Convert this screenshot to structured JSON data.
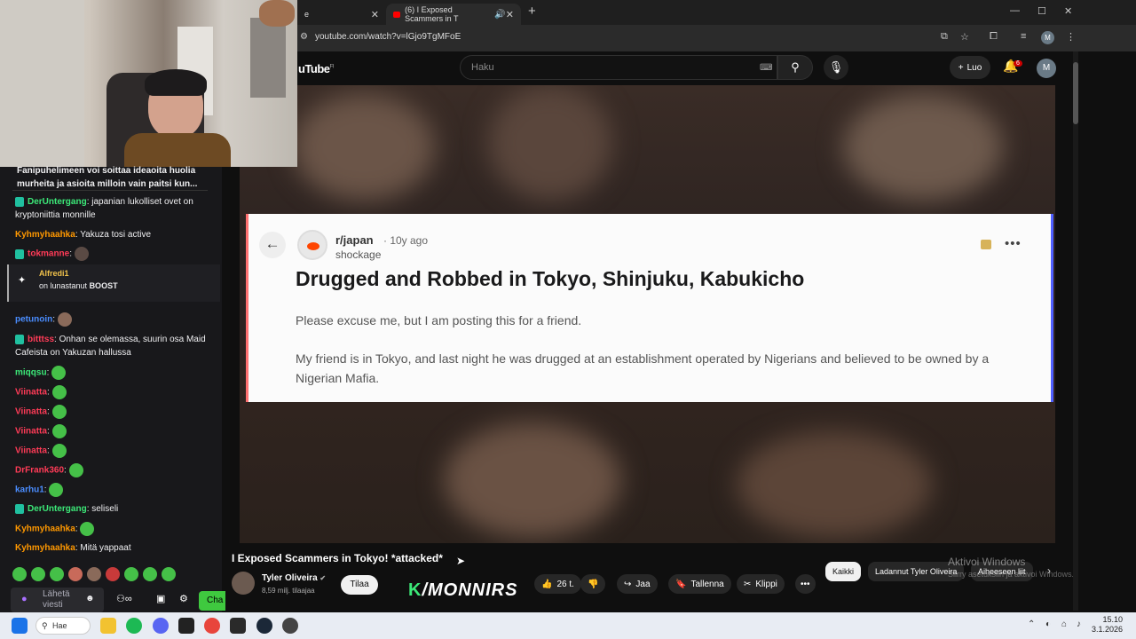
{
  "browser": {
    "tabs": [
      {
        "label": "e"
      },
      {
        "label": "(6) I Exposed Scammers in T"
      }
    ],
    "new_tab": "+",
    "url": "youtube.com/watch?v=lGjo9TgMFoE",
    "window_controls": [
      "—",
      "☐",
      "✕"
    ]
  },
  "youtube": {
    "logo": "uTube",
    "region": "FI",
    "search_placeholder": "Haku",
    "create_label": "Luo",
    "notification_count": "6",
    "avatar_letter": "M",
    "video_title": "I Exposed Scammers in Tokyo! *attacked*",
    "channel_name": "Tyler Oliveira",
    "subscribers": "8,59 milj. tilaajaa",
    "subscribe_label": "Tilaa",
    "likes": "26 t.",
    "share_label": "Jaa",
    "save_label": "Tallenna",
    "clip_label": "Klippi",
    "chips": [
      "Kaikki",
      "Ladannut Tyler Oliveira",
      "Aiheeseen liit"
    ],
    "overlay_logo": "/MONNIRS",
    "overlay_letter": "K"
  },
  "reddit_post": {
    "subreddit": "r/japan",
    "age": "· 10y ago",
    "author": "shockage",
    "title": "Drugged and Robbed in Tokyo, Shinjuku, Kabukicho",
    "para1": "Please excuse me, but I am posting this for a friend.",
    "para2": "My friend is in Tokyo, and last night he was drugged at an establishment operated by Nigerians and believed to be owned by a Nigerian Mafia."
  },
  "windows_watermark": {
    "line1": "Aktivoi Windows",
    "line2": "Siirry asetuksiin ja aktivoi Windows."
  },
  "chat": {
    "top_message": "Fanipuhelimeen voi soittaa ideaoita huolia murheita ja asioita milloin vain paitsi kun...",
    "messages": [
      {
        "user": "DerUntergang",
        "text": "japanian lukolliset ovet on kryptoniittia monnille",
        "color": "#3ce878"
      },
      {
        "user": "Kyhmyhaahka",
        "text": "Yakuza tosi active",
        "color": "#ff9800"
      },
      {
        "user": "tokmanne",
        "text": "",
        "color": "#ff3b57"
      },
      {
        "user": "petunoin",
        "text": "",
        "color": "#4a8dff"
      },
      {
        "user": "bitttss",
        "text": "Onhan se olemassa, suurin osa Maid Cafeista on Yakuzan hallussa",
        "color": "#ff3b57"
      },
      {
        "user": "miqqsu",
        "text": "",
        "color": "#3ce878"
      },
      {
        "user": "Viinatta",
        "text": "",
        "color": "#ff3b57"
      },
      {
        "user": "Viinatta",
        "text": "",
        "color": "#ff3b57"
      },
      {
        "user": "Viinatta",
        "text": "",
        "color": "#ff3b57"
      },
      {
        "user": "Viinatta",
        "text": "",
        "color": "#ff3b57"
      },
      {
        "user": "DrFrank360",
        "text": "",
        "color": "#ff3b57"
      },
      {
        "user": "karhu1",
        "text": "",
        "color": "#4a8dff"
      },
      {
        "user": "DerUntergang",
        "text": "seliseli",
        "color": "#3ce878"
      },
      {
        "user": "Kyhmyhaahka",
        "text": "",
        "color": "#ff9800"
      },
      {
        "user": "Kyhmyhaahka",
        "text": "Mitä yappaat",
        "color": "#ff9800"
      }
    ],
    "boost": {
      "user": "Alfredi1",
      "line": "on lunastanut",
      "item": "BOOST"
    },
    "input_placeholder": "Lähetä viesti",
    "chat_button": "Cha"
  },
  "taskbar": {
    "search": "Hae",
    "time": "15.10",
    "date": "3.1.2026"
  }
}
